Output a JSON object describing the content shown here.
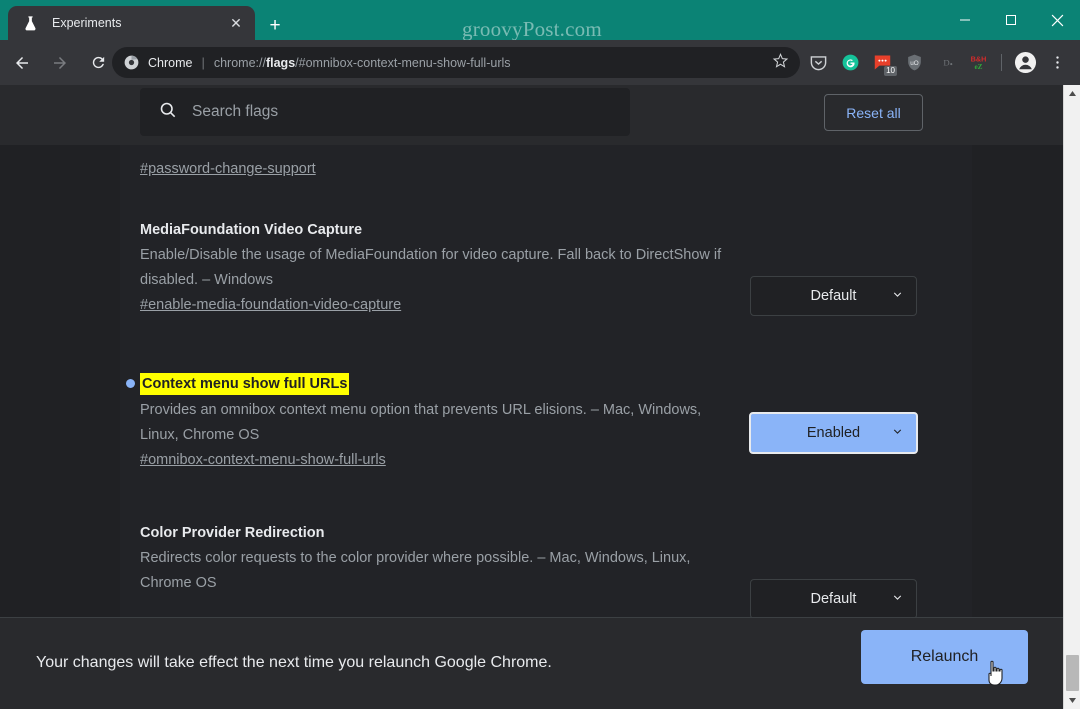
{
  "window": {
    "watermark": "groovyPost.com",
    "titlebar_color": "#0b8375",
    "controls": {
      "minimize": "–",
      "maximize": "☐",
      "close": "✕"
    }
  },
  "tabstrip": {
    "tab": {
      "title": "Experiments",
      "favicon": "flask-icon",
      "close_label": "✕"
    },
    "new_tab_label": "+"
  },
  "toolbar": {
    "back_label": "←",
    "forward_label": "→",
    "reload_label": "↻",
    "omnibox": {
      "site_label": "Chrome",
      "separator": "|",
      "url_prefix": "chrome://",
      "url_bold": "flags",
      "url_suffix": "/#omnibox-context-menu-show-full-urls",
      "url_full": "chrome://flags/#omnibox-context-menu-show-full-urls",
      "star_label": "☆"
    },
    "extensions": [
      {
        "name": "pocket-icon",
        "badge": ""
      },
      {
        "name": "grammarly-icon",
        "badge": ""
      },
      {
        "name": "notifications-icon",
        "badge": "10"
      },
      {
        "name": "ublock-origin-icon",
        "badge": ""
      },
      {
        "name": "dashlane-icon",
        "badge": ""
      },
      {
        "name": "bh-photo-icon",
        "badge": ""
      }
    ],
    "profile_label": "profile-icon",
    "menu_label": "⋮"
  },
  "flags_page": {
    "search": {
      "placeholder": "Search flags",
      "value": "",
      "icon": "search-icon"
    },
    "reset_all_label": "Reset all",
    "flags": [
      {
        "id": "password-change-support",
        "title": "",
        "description": "",
        "link": "#password-change-support",
        "select_value": "",
        "highlighted": false,
        "partial": true
      },
      {
        "id": "enable-media-foundation-video-capture",
        "title": "MediaFoundation Video Capture",
        "description": "Enable/Disable the usage of MediaFoundation for video capture. Fall back to DirectShow if disabled. – Windows",
        "link": "#enable-media-foundation-video-capture",
        "select_value": "Default",
        "highlighted": false,
        "partial": false
      },
      {
        "id": "omnibox-context-menu-show-full-urls",
        "title": "Context menu show full URLs",
        "description": "Provides an omnibox context menu option that prevents URL elisions. – Mac, Windows, Linux, Chrome OS",
        "link": "#omnibox-context-menu-show-full-urls",
        "select_value": "Enabled",
        "highlighted": true,
        "partial": false
      },
      {
        "id": "color-provider-redirection",
        "title": "Color Provider Redirection",
        "description": "Redirects color requests to the color provider where possible. – Mac, Windows, Linux, Chrome OS",
        "link": "",
        "select_value": "Default",
        "highlighted": false,
        "partial": false
      }
    ],
    "relaunch": {
      "message": "Your changes will take effect the next time you relaunch Google Chrome.",
      "button_label": "Relaunch"
    }
  },
  "colors": {
    "accent_blue": "#8ab4f8",
    "highlight_yellow": "#ffff00",
    "teal_titlebar": "#0b8375",
    "page_bg": "#202124",
    "panel_bg": "#292a2d"
  },
  "chevron": "⌄"
}
